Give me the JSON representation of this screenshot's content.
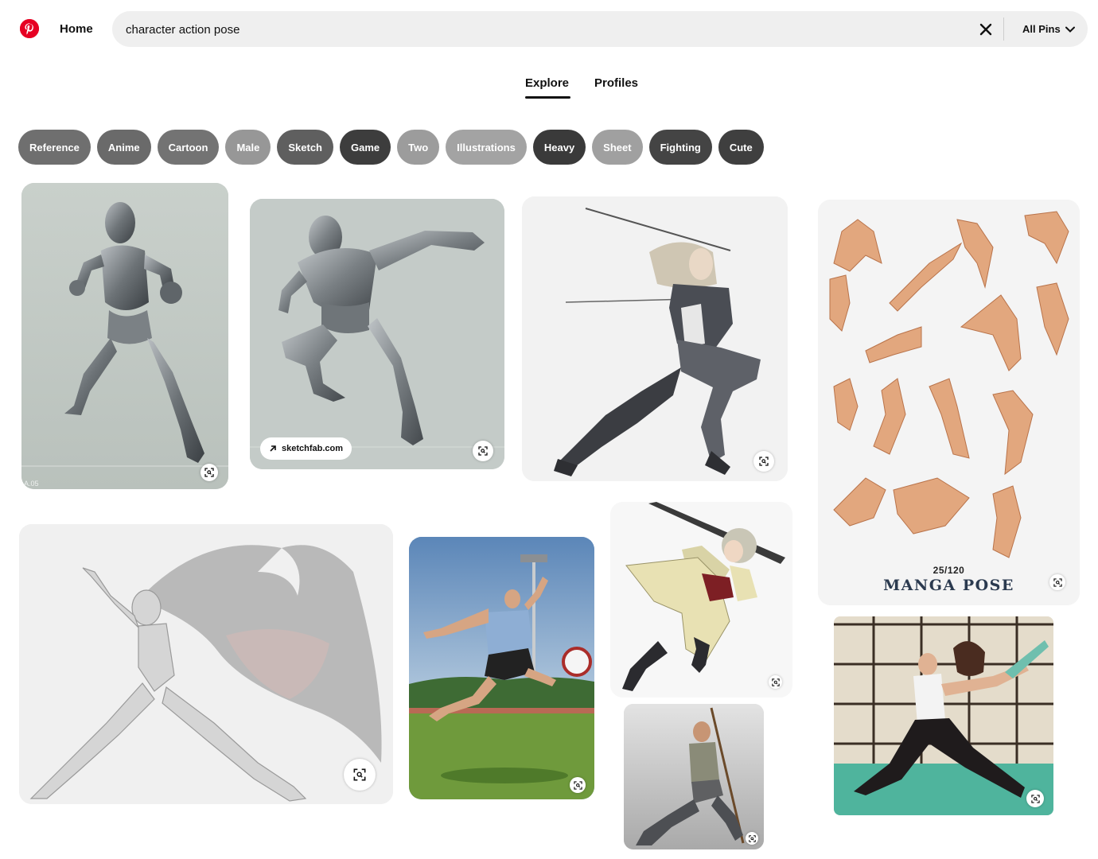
{
  "header": {
    "home_label": "Home",
    "search_value": "character action pose",
    "filter_label": "All Pins"
  },
  "tabs": [
    {
      "label": "Explore",
      "active": true
    },
    {
      "label": "Profiles",
      "active": false
    }
  ],
  "chips": [
    {
      "label": "Reference",
      "color": "#6f6f6f"
    },
    {
      "label": "Anime",
      "color": "#6a6a6a"
    },
    {
      "label": "Cartoon",
      "color": "#737373"
    },
    {
      "label": "Male",
      "color": "#979797"
    },
    {
      "label": "Sketch",
      "color": "#5f5f5f"
    },
    {
      "label": "Game",
      "color": "#3d3d3d"
    },
    {
      "label": "Two",
      "color": "#9c9c9c"
    },
    {
      "label": "Illustrations",
      "color": "#a3a3a3"
    },
    {
      "label": "Heavy",
      "color": "#3a3a3a"
    },
    {
      "label": "Sheet",
      "color": "#a0a0a0"
    },
    {
      "label": "Fighting",
      "color": "#444444"
    },
    {
      "label": "Cute",
      "color": "#3f3f3f"
    }
  ],
  "pins": {
    "mannequin_fist": {
      "watermark": "A.05"
    },
    "mannequin_lunge": {
      "source": "sketchfab.com"
    },
    "manga_sheet": {
      "counter": "25/120",
      "title": "MANGA POSE"
    }
  },
  "colors": {
    "brand": "#e60023",
    "search_bg": "#efefef"
  },
  "icons": {
    "logo": "pinterest-logo-icon",
    "clear": "close-icon",
    "dropdown": "chevron-down-icon",
    "visual_search": "visual-search-icon",
    "source": "arrow-up-right-icon"
  }
}
